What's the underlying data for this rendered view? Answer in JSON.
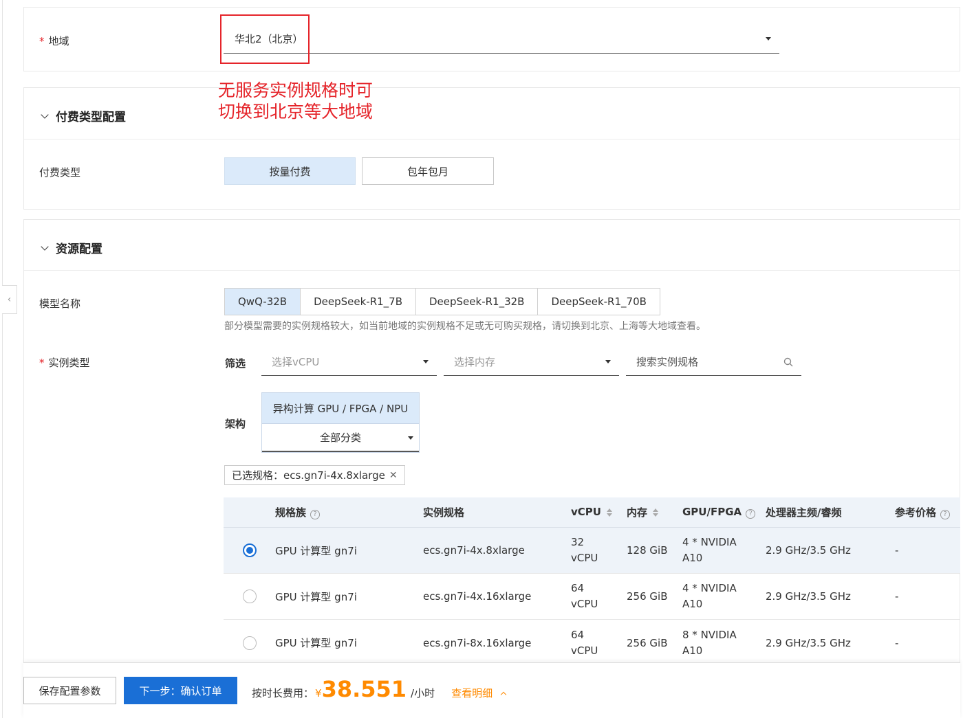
{
  "region": {
    "label": "地域",
    "value": "华北2（北京）"
  },
  "annotation": {
    "line1": "无服务实例规格时可",
    "line2": "切换到北京等大地域"
  },
  "billing": {
    "section_title": "付费类型配置",
    "label": "付费类型",
    "options": [
      "按量付费",
      "包年包月"
    ]
  },
  "resource": {
    "section_title": "资源配置",
    "model_label": "模型名称",
    "models": [
      "QwQ-32B",
      "DeepSeek-R1_7B",
      "DeepSeek-R1_32B",
      "DeepSeek-R1_70B"
    ],
    "model_hint": "部分模型需要的实例规格较大，如当前地域的实例规格不足或无可购买规格，请切换到北京、上海等大地域查看。",
    "instance_label": "实例类型",
    "filter_label": "筛选",
    "vcpu_placeholder": "选择vCPU",
    "memory_placeholder": "选择内存",
    "search_placeholder": "搜索实例规格",
    "arch_label": "架构",
    "arch_value": "异构计算 GPU / FPGA / NPU",
    "category_value": "全部分类",
    "selected_tag": "已选规格：ecs.gn7i-4x.8xlarge"
  },
  "table": {
    "headers": [
      "规格族",
      "实例规格",
      "vCPU",
      "内存",
      "GPU/FPGA",
      "处理器主频/睿频",
      "参考价格"
    ],
    "rows": [
      {
        "family": "GPU 计算型 gn7i",
        "spec": "ecs.gn7i-4x.8xlarge",
        "vcpu_num": "32",
        "vcpu_unit": "vCPU",
        "memory": "128 GiB",
        "gpu_line1": "4 * NVIDIA",
        "gpu_line2": "A10",
        "freq": "2.9 GHz/3.5 GHz",
        "price": "-",
        "selected": true
      },
      {
        "family": "GPU 计算型 gn7i",
        "spec": "ecs.gn7i-4x.16xlarge",
        "vcpu_num": "64",
        "vcpu_unit": "vCPU",
        "memory": "256 GiB",
        "gpu_line1": "4 * NVIDIA",
        "gpu_line2": "A10",
        "freq": "2.9 GHz/3.5 GHz",
        "price": "-",
        "selected": false
      },
      {
        "family": "GPU 计算型 gn7i",
        "spec": "ecs.gn7i-8x.16xlarge",
        "vcpu_num": "64",
        "vcpu_unit": "vCPU",
        "memory": "256 GiB",
        "gpu_line1": "8 * NVIDIA",
        "gpu_line2": "A10",
        "freq": "2.9 GHz/3.5 GHz",
        "price": "-",
        "selected": false
      }
    ]
  },
  "footer": {
    "save_label": "保存配置参数",
    "next_label": "下一步：确认订单",
    "fee_label": "按时长费用：",
    "currency": "¥",
    "price": "38.551",
    "unit": "/小时",
    "detail_label": "查看明细"
  },
  "colors": {
    "primary": "#1a6fd6",
    "price": "#ff8a00",
    "annotation": "#e5242a",
    "active_bg": "#dbeafa"
  }
}
